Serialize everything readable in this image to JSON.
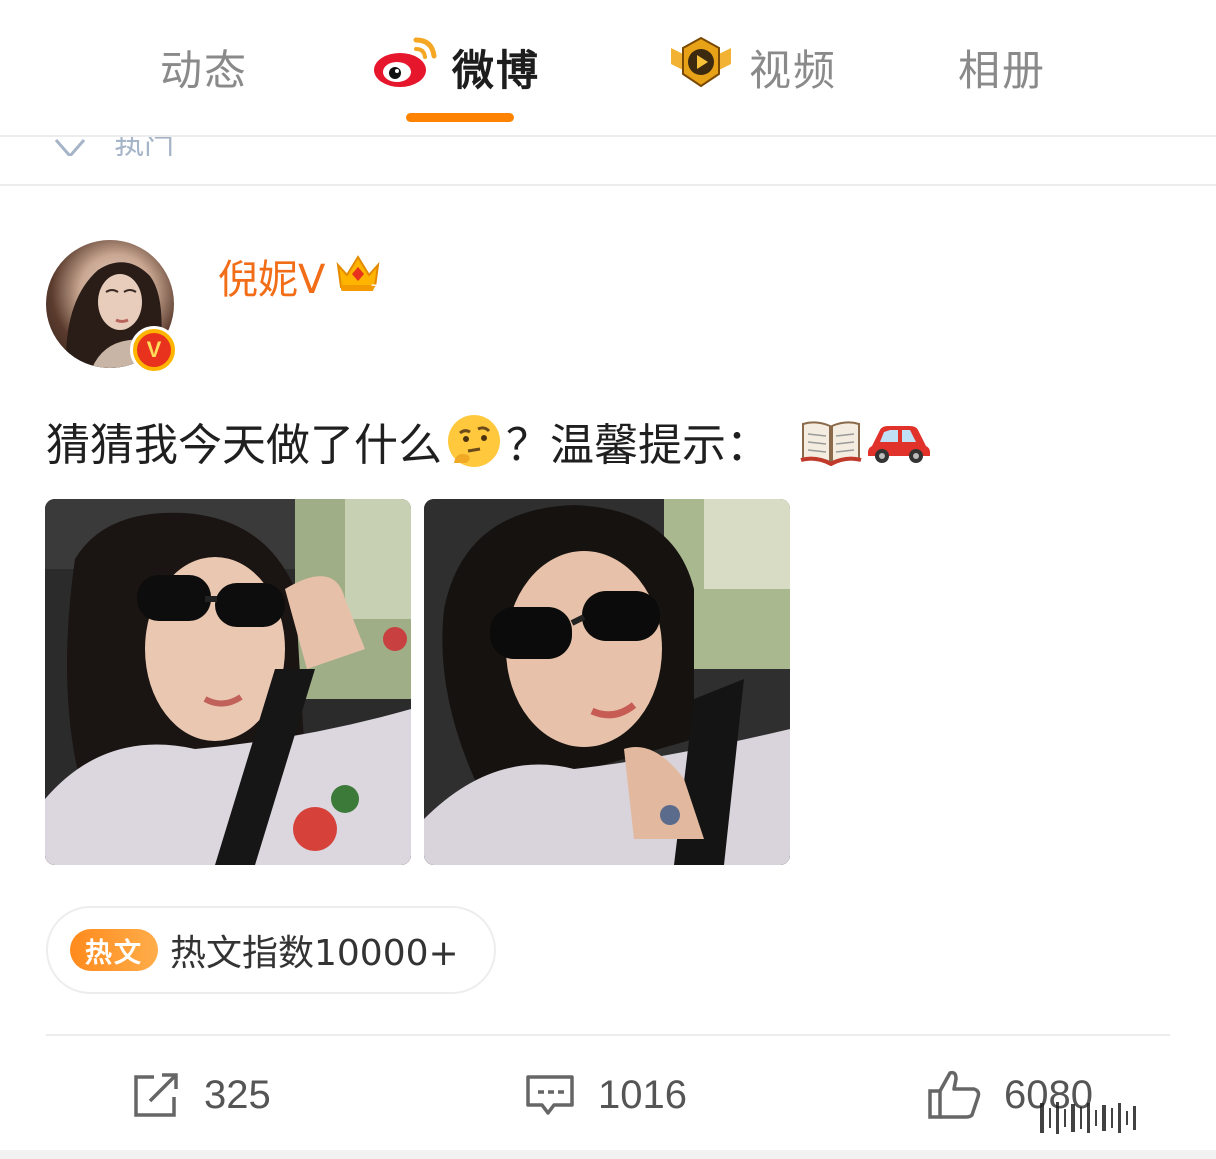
{
  "tabs": [
    {
      "label": "动态",
      "active": false
    },
    {
      "label": "微博",
      "active": true,
      "icon": "weibo-logo-icon"
    },
    {
      "label": "视频",
      "active": false,
      "icon": "video-play-badge-icon"
    },
    {
      "label": "相册",
      "active": false
    }
  ],
  "accent_color": "#ff8200",
  "peek_text": "热门",
  "post": {
    "username": "倪妮V",
    "username_color": "#f26d18",
    "verified_badge": "V",
    "member_icon": "crown-icon",
    "text_part1": "猜猜我今天做了什么",
    "text_part2": "？温馨提示：",
    "emojis": [
      "thinking-face-emoji",
      "open-book-emoji",
      "red-car-emoji"
    ],
    "photos": [
      {
        "alt": "selfie-in-car-1"
      },
      {
        "alt": "selfie-in-car-2"
      }
    ],
    "hot": {
      "tag": "热文",
      "text": "热文指数10000+"
    }
  },
  "actions": {
    "repost_count": "325",
    "comment_count": "1016",
    "like_count": "6080"
  }
}
